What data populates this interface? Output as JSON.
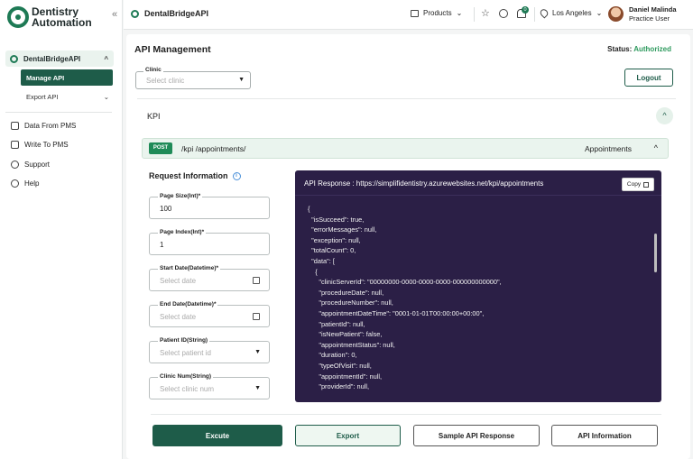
{
  "brand": {
    "line1": "Dentistry",
    "line2": "Automation"
  },
  "sidebar": {
    "group_label": "DentalBridgeAPI",
    "sub_active": "Manage API",
    "sub_export": "Export API",
    "items": [
      {
        "label": "Data From PMS",
        "icon": "database-icon"
      },
      {
        "label": "Write To PMS",
        "icon": "edit-icon"
      },
      {
        "label": "Support",
        "icon": "support-icon"
      },
      {
        "label": "Help",
        "icon": "help-icon"
      }
    ]
  },
  "topbar": {
    "title": "DentalBridgeAPI",
    "products": "Products",
    "notifications": "0",
    "location": "Los Angeles",
    "user_name": "Daniel Malinda",
    "user_role": "Practice User"
  },
  "main": {
    "title": "API Management",
    "status_label": "Status:",
    "status_value": "Authorized",
    "clinic_label": "Clinic",
    "clinic_placeholder": "Select clinic",
    "logout": "Logout",
    "section": "KPI",
    "endpoint": {
      "method": "POST",
      "path": "/kpi /appointments/",
      "name": "Appointments"
    },
    "request_title": "Request Information",
    "fields": [
      {
        "label": "Page Size(Int)*",
        "value": "100"
      },
      {
        "label": "Page Index(Int)*",
        "value": "1"
      },
      {
        "label": "Start Date(Datetime)*",
        "placeholder": "Select date"
      },
      {
        "label": "End Date(Datetime)*",
        "placeholder": "Select date"
      },
      {
        "label": "Patient ID(String)",
        "placeholder": "Select patient id"
      },
      {
        "label": "Clinic Num(String)",
        "placeholder": "Select clinic num"
      }
    ],
    "response_header": "API Response : https://simplifidentistry.azurewebsites.net/kpi/appointments",
    "copy": "Copy",
    "response_body": "{\n  \"isSucceed\": true,\n  \"errorMessages\": null,\n  \"exception\": null,\n  \"totalCount\": 0,\n  \"data\": [\n    {\n      \"clinicServerId\": \"00000000-0000-0000-0000-000000000000\",\n      \"procedureDate\": null,\n      \"procedureNumber\": null,\n      \"appointmentDateTime\": \"0001-01-01T00:00:00+00:00\",\n      \"patientId\": null,\n      \"isNewPatient\": false,\n      \"appointmentStatus\": null,\n      \"duration\": 0,\n      \"typeOfVisit\": null,\n      \"appointmentId\": null,\n      \"providerId\": null,",
    "buttons": {
      "execute": "Excute",
      "export": "Export",
      "sample": "Sample API Response",
      "info": "API Information"
    }
  }
}
